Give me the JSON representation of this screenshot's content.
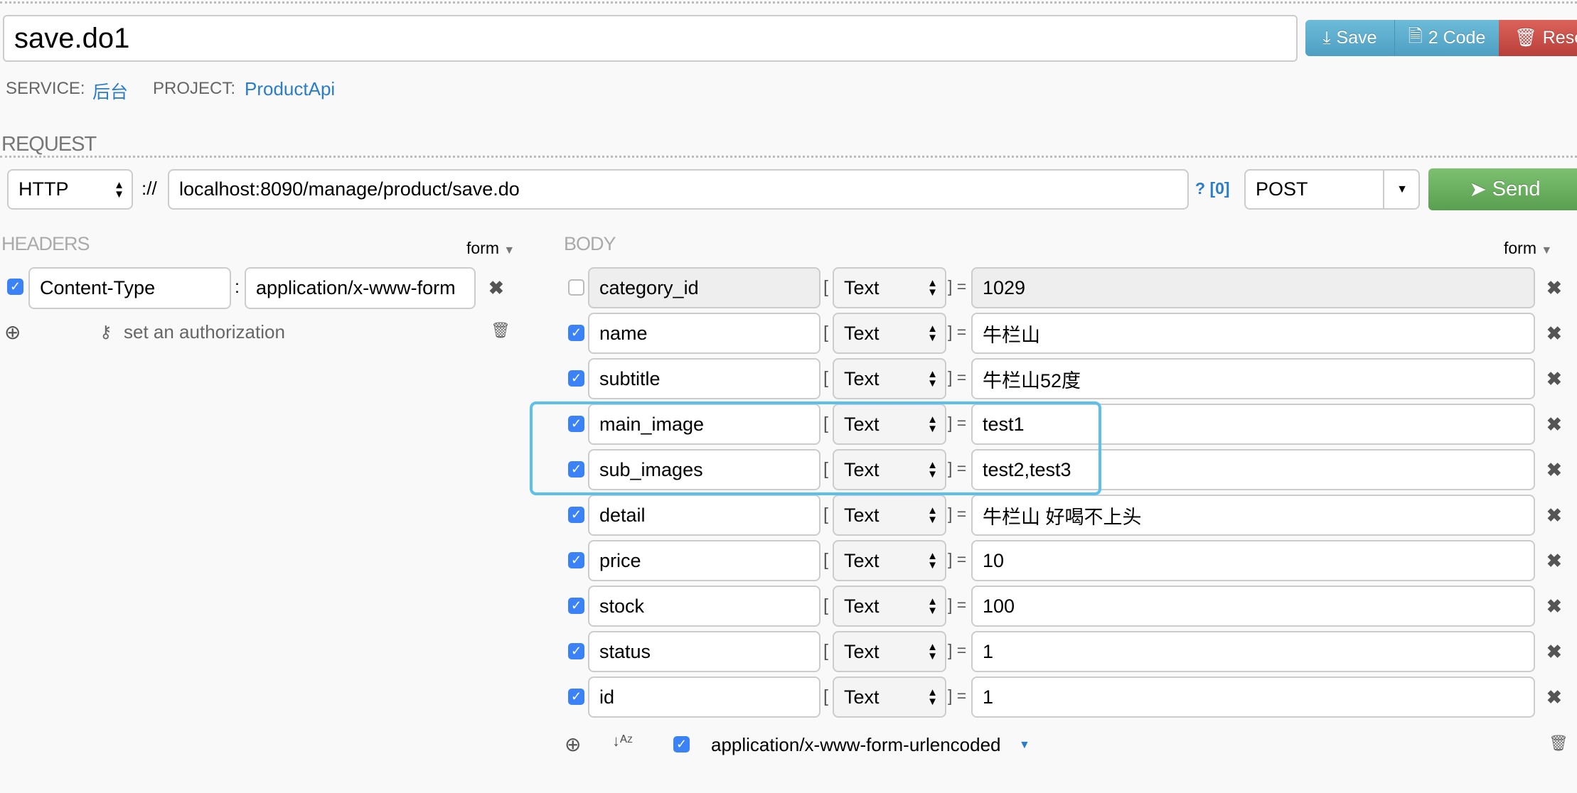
{
  "title_input": "save.do1",
  "toolbar": {
    "save": "Save",
    "code": "2 Code",
    "reset": "Reset"
  },
  "meta": {
    "service_label": "SERVICE:",
    "service": "后台",
    "project_label": "PROJECT:",
    "project": "ProductApi"
  },
  "request": {
    "section_label": "REQUEST",
    "protocol": "HTTP",
    "separator": "://",
    "url": "localhost:8090/manage/product/save.do",
    "params_link": "? [0]",
    "method": "POST",
    "send": "Send"
  },
  "headers": {
    "section_label": "HEADERS",
    "mode": "form",
    "items": [
      {
        "checked": true,
        "key": "Content-Type",
        "value": "application/x-www-form"
      }
    ],
    "authorization": "set an authorization"
  },
  "body": {
    "section_label": "BODY",
    "mode": "form",
    "items": [
      {
        "checked": false,
        "key": "category_id",
        "type": "Text",
        "value": "1029"
      },
      {
        "checked": true,
        "key": "name",
        "type": "Text",
        "value": "牛栏山"
      },
      {
        "checked": true,
        "key": "subtitle",
        "type": "Text",
        "value": "牛栏山52度"
      },
      {
        "checked": true,
        "key": "main_image",
        "type": "Text",
        "value": "test1"
      },
      {
        "checked": true,
        "key": "sub_images",
        "type": "Text",
        "value": "test2,test3"
      },
      {
        "checked": true,
        "key": "detail",
        "type": "Text",
        "value": "牛栏山 好喝不上头"
      },
      {
        "checked": true,
        "key": "price",
        "type": "Text",
        "value": "10"
      },
      {
        "checked": true,
        "key": "stock",
        "type": "Text",
        "value": "100"
      },
      {
        "checked": true,
        "key": "status",
        "type": "Text",
        "value": "1"
      },
      {
        "checked": true,
        "key": "id",
        "type": "Text",
        "value": "1"
      }
    ],
    "bracket_open": "[",
    "bracket_close": "] =",
    "encoding": "application/x-www-form-urlencoded",
    "encoding_checked": true
  },
  "colors": {
    "primary": "#5aaed0",
    "danger": "#c9443e",
    "success": "#5eaa55",
    "checkbox": "#3b82f6",
    "highlight": "#5bc0eb",
    "link": "#2a7dc9"
  }
}
